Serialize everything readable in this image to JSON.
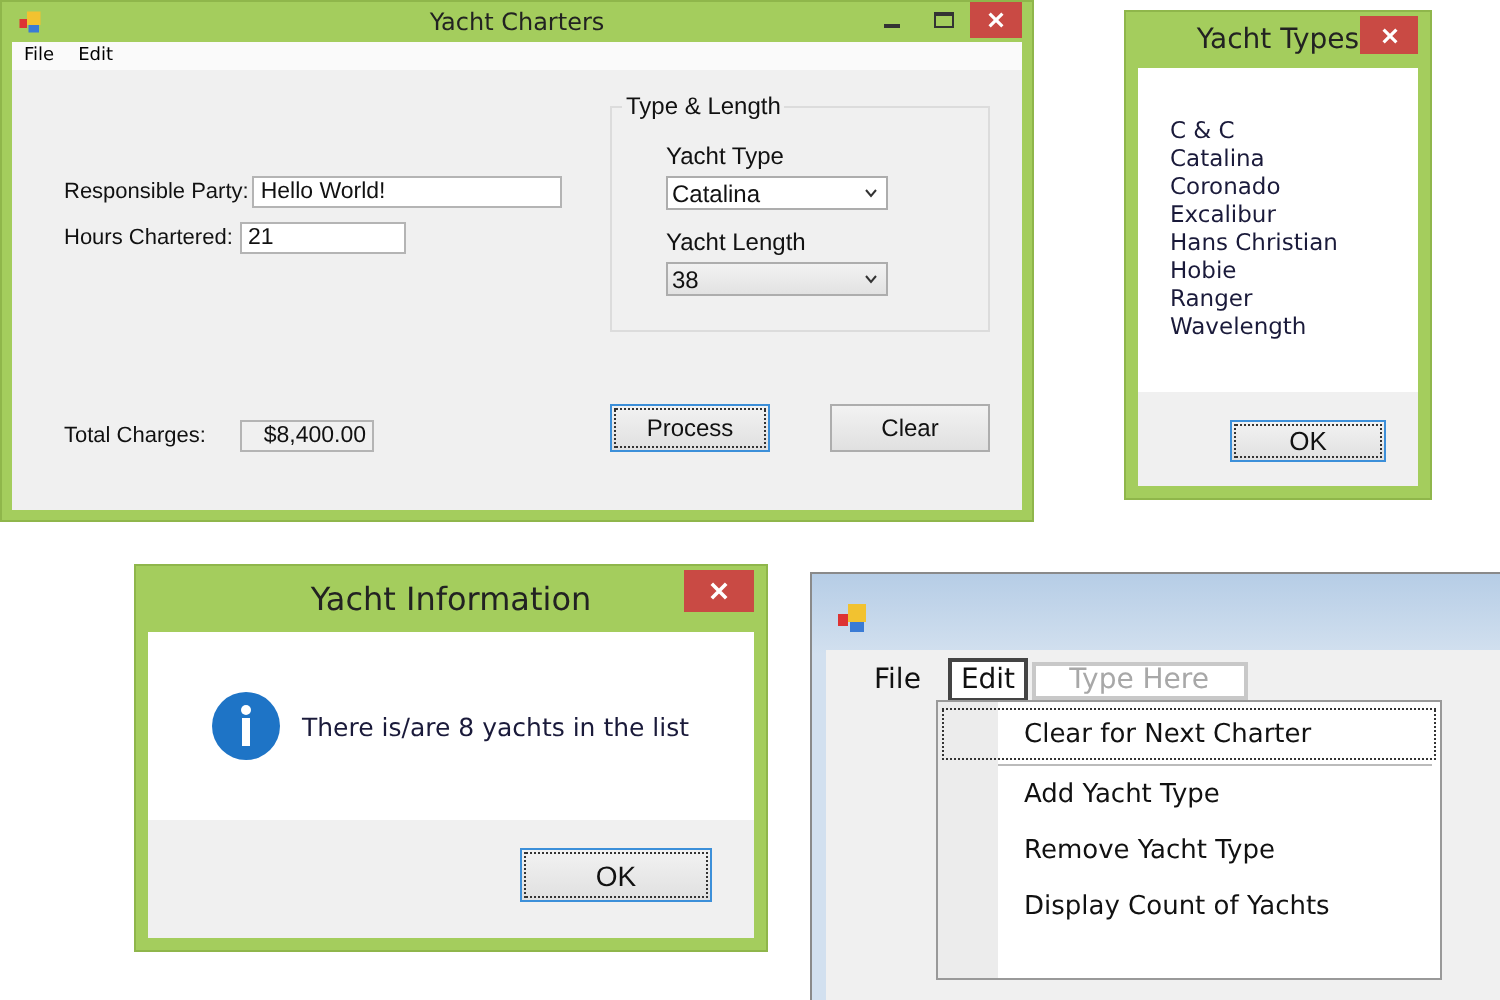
{
  "main_window": {
    "title": "Yacht Charters",
    "menu": [
      "File",
      "Edit"
    ],
    "fields": [
      {
        "label": "Responsible Party:",
        "value": "Hello World!",
        "wide": true
      },
      {
        "label": "Hours Chartered:",
        "value": "21",
        "wide": false
      }
    ],
    "group": {
      "title": "Type & Length",
      "combos": [
        {
          "label": "Yacht Type",
          "value": "Catalina",
          "editable": true
        },
        {
          "label": "Yacht Length",
          "value": "38",
          "editable": false
        }
      ]
    },
    "total": {
      "label": "Total Charges:",
      "value": "$8,400.00"
    },
    "buttons": [
      {
        "label": "Process",
        "focused": true
      },
      {
        "label": "Clear",
        "focused": false
      }
    ]
  },
  "types_window": {
    "title": "Yacht Types",
    "items": [
      "C & C",
      "Catalina",
      "Coronado",
      "Excalibur",
      "Hans Christian",
      "Hobie",
      "Ranger",
      "Wavelength"
    ],
    "button": "OK"
  },
  "info_window": {
    "title": "Yacht Information",
    "message": "There is/are 8 yachts in the list",
    "button": "OK"
  },
  "designer": {
    "menu": [
      {
        "label": "File",
        "selected": false
      },
      {
        "label": "Edit",
        "selected": true
      }
    ],
    "placeholder": "Type Here",
    "dropdown": [
      {
        "kind": "item",
        "label": "Clear for Next Charter",
        "focused": true
      },
      {
        "kind": "separator"
      },
      {
        "kind": "item",
        "label": "Add Yacht Type",
        "focused": false
      },
      {
        "kind": "item",
        "label": "Remove Yacht Type",
        "focused": false
      },
      {
        "kind": "item",
        "label": "Display Count of Yachts",
        "focused": false
      }
    ]
  }
}
